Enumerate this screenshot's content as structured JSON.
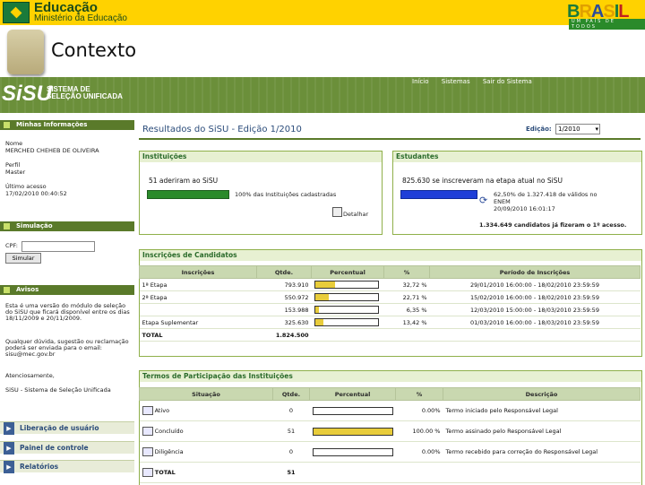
{
  "top": {
    "mec_title": "Educação",
    "mec_subtitle": "Ministério da Educação",
    "brasil_letters": [
      "B",
      "R",
      "A",
      "S",
      "I",
      "L"
    ],
    "brasil_colors": [
      "#1a7a3a",
      "#e0a000",
      "#2b4c9a",
      "#e0a000",
      "#1a7a3a",
      "#c02020"
    ],
    "brasil_slogan": "UM PAÍS DE TODOS"
  },
  "slide": {
    "title": "Contexto"
  },
  "sisu_header": {
    "logo": "SiSU",
    "name_line1": "SISTEMA DE",
    "name_line2": "SELEÇÃO UNIFICADA",
    "links": [
      "Início",
      "Sistemas",
      "Sair do Sistema"
    ]
  },
  "sidebar": {
    "minhas_info": {
      "title": "Minhas Informações",
      "nome_label": "Nome",
      "nome_value": "MERCHED CHEHEB DE OLIVEIRA",
      "perfil_label": "Perfil",
      "perfil_value": "Master",
      "acesso_label": "Último acesso",
      "acesso_value": "17/02/2010 00:40:52"
    },
    "simulacao": {
      "title": "Simulação",
      "cpf_label": "CPF:",
      "button": "Simular"
    },
    "avisos": {
      "title": "Avisos",
      "text1": "Esta é uma versão do módulo de seleção do SiSU que ficará disponível entre os dias 18/11/2009 e 20/11/2009.",
      "text2": "Qualquer dúvida, sugestão ou reclamação poderá ser enviada para o email: sisu@mec.gov.br",
      "text3": "Atenciosamente,",
      "text4": "SiSU - Sistema de Seleção Unificada"
    },
    "nav": [
      "Liberação de usuário",
      "Painel de controle",
      "Relatórios"
    ]
  },
  "main": {
    "title": "Resultados do SiSU - Edição 1/2010",
    "edicao_label": "Edição:",
    "edicao_value": "1/2010",
    "instituicoes": {
      "title": "Instituições",
      "headline": "51 aderiram ao SiSU",
      "percent_text": "100% das Instituições cadastradas",
      "percent": 1.0,
      "detail": "Detalhar"
    },
    "estudantes": {
      "title": "Estudantes",
      "headline": "825.630 se inscreveram na etapa atual no SiSU",
      "bar_fraction": 0.7,
      "note1": "62,50% de 1.327.418 de válidos no",
      "note2": "ENEM",
      "note3": "20/09/2010 16:01:17",
      "total": "1.334.649 candidatos já fizeram o 1º acesso."
    },
    "inscricoes": {
      "title": "Inscrições de Candidatos",
      "headers": [
        "Inscrições",
        "Qtde.",
        "Percentual",
        "%",
        "Período de Inscrições"
      ],
      "rows": [
        {
          "label": "1ª Etapa",
          "qtde": "793.910",
          "pct": "32,72 %",
          "pct_value": 32.72,
          "periodo": "29/01/2010 16:00:00 - 18/02/2010 23:59:59"
        },
        {
          "label": "2ª Etapa",
          "qtde": "550.972",
          "pct": "22,71 %",
          "pct_value": 22.71,
          "periodo": "15/02/2010 16:00:00 - 18/02/2010 23:59:59"
        },
        {
          "label": "",
          "qtde": "153.988",
          "pct": "6,35 %",
          "pct_value": 6.35,
          "periodo": "12/03/2010 15:00:00 - 18/03/2010 23:59:59"
        },
        {
          "label": "Etapa Suplementar",
          "qtde": "325.630",
          "pct": "13,42 %",
          "pct_value": 13.42,
          "periodo": "01/03/2010 16:00:00 - 18/03/2010 23:59:59"
        },
        {
          "label": "TOTAL",
          "qtde": "1.824.500",
          "pct": "",
          "pct_value": null,
          "periodo": ""
        }
      ]
    },
    "termos": {
      "title": "Termos de Participação das Instituições",
      "headers": [
        "Situação",
        "Qtde.",
        "Percentual",
        "%",
        "Descrição"
      ],
      "rows": [
        {
          "label": "Ativo",
          "qtde": "0",
          "pct": "0.00%",
          "pct_value": 0,
          "desc": "Termo iniciado pelo Responsável Legal"
        },
        {
          "label": "Concluído",
          "qtde": "51",
          "pct": "100.00 %",
          "pct_value": 100,
          "desc": "Termo assinado pelo Responsável Legal"
        },
        {
          "label": "Diligência",
          "qtde": "0",
          "pct": "0.00%",
          "pct_value": 0,
          "desc": "Termo recebido para correção do Responsável Legal"
        },
        {
          "label": "TOTAL",
          "qtde": "51",
          "pct": "",
          "pct_value": null,
          "desc": ""
        }
      ]
    }
  }
}
